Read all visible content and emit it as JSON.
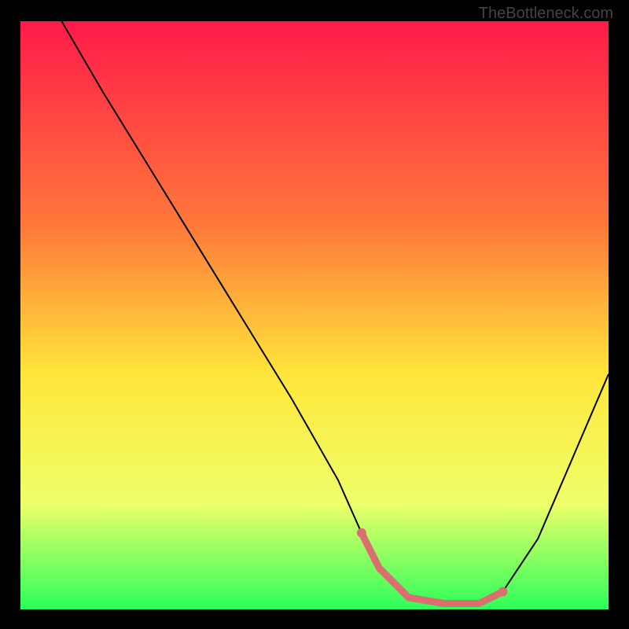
{
  "watermark": "TheBottleneck.com",
  "chart_data": {
    "type": "line",
    "title": "",
    "xlabel": "",
    "ylabel": "",
    "xlim": [
      0,
      100
    ],
    "ylim": [
      0,
      100
    ],
    "gradient_stops": [
      {
        "offset": 0,
        "color": "#ff1a4a"
      },
      {
        "offset": 35,
        "color": "#ff7a3a"
      },
      {
        "offset": 60,
        "color": "#ffe63a"
      },
      {
        "offset": 82,
        "color": "#eeff6a"
      },
      {
        "offset": 100,
        "color": "#2bff5a"
      }
    ],
    "series": [
      {
        "name": "bottleneck-curve",
        "color": "#000000",
        "x": [
          7,
          14,
          22,
          30,
          38,
          46,
          54,
          58,
          61,
          66,
          72,
          78,
          82,
          88,
          94,
          100
        ],
        "values": [
          100,
          88,
          75,
          62,
          49,
          36,
          22,
          13,
          7,
          2,
          1,
          1,
          3,
          12,
          26,
          40
        ]
      }
    ],
    "highlight": {
      "name": "optimal-range",
      "color": "#d9706f",
      "x": [
        58,
        61,
        66,
        72,
        78,
        82
      ],
      "values": [
        13,
        7,
        2,
        1,
        1,
        3
      ]
    }
  }
}
